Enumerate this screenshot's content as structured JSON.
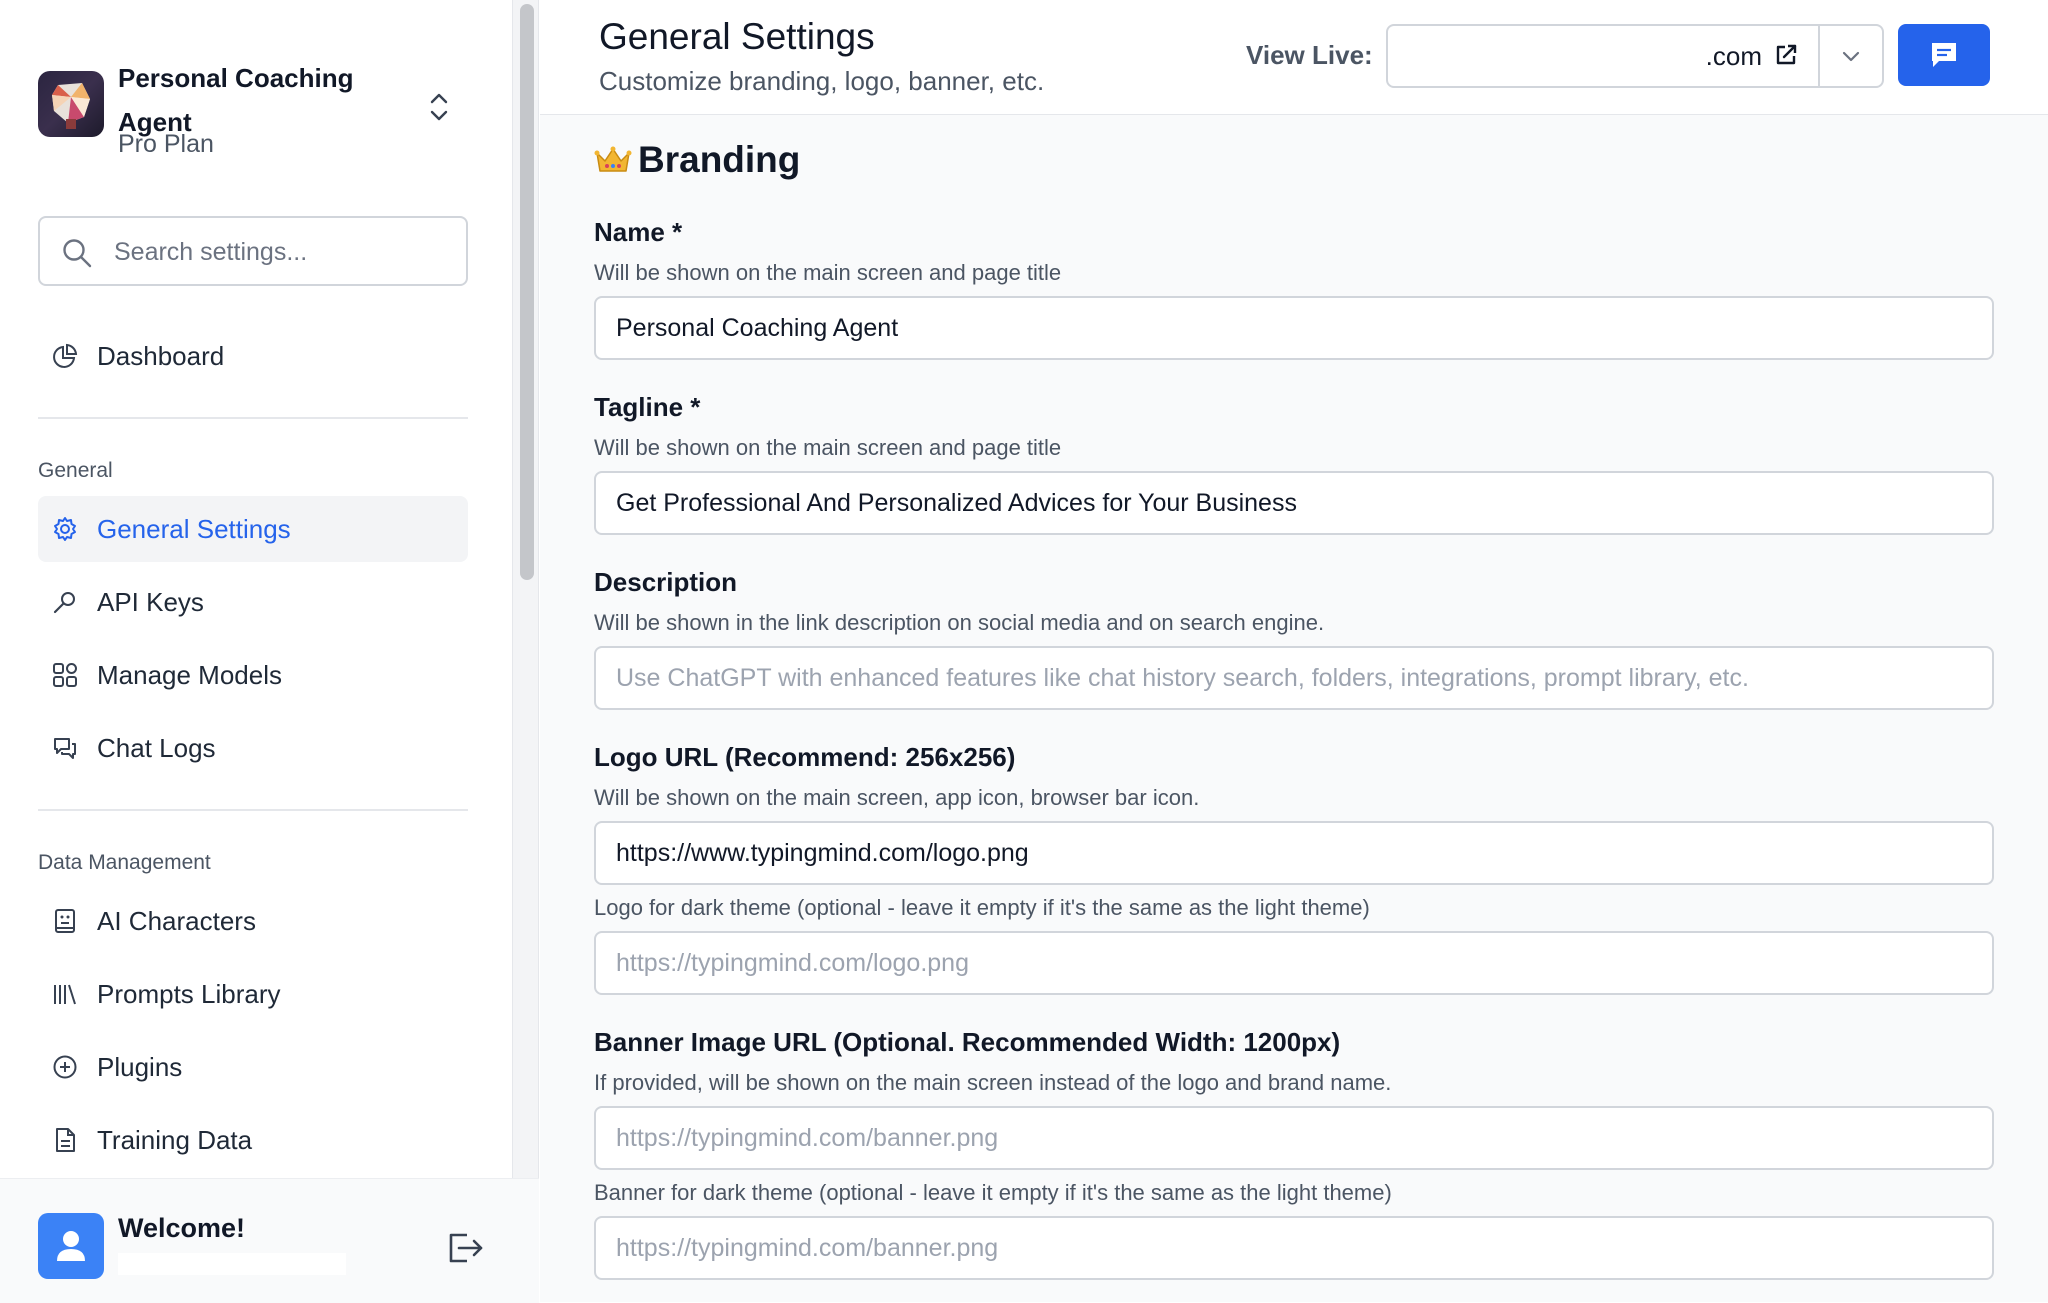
{
  "sidebar": {
    "workspace": {
      "name": "Personal Coaching Agent",
      "plan": "Pro Plan"
    },
    "search_placeholder": "Search settings...",
    "dashboard_label": "Dashboard",
    "general_section": "General",
    "general_items": [
      {
        "label": "General Settings",
        "icon": "gear-icon",
        "active": true
      },
      {
        "label": "API Keys",
        "icon": "key-icon"
      },
      {
        "label": "Manage Models",
        "icon": "grid-icon"
      },
      {
        "label": "Chat Logs",
        "icon": "chat-bubbles-icon"
      }
    ],
    "data_section": "Data Management",
    "data_items": [
      {
        "label": "AI Characters",
        "icon": "character-icon"
      },
      {
        "label": "Prompts Library",
        "icon": "library-icon"
      },
      {
        "label": "Plugins",
        "icon": "plus-circle-icon"
      },
      {
        "label": "Training Data",
        "icon": "document-icon"
      }
    ],
    "footer": {
      "welcome": "Welcome!"
    }
  },
  "header": {
    "title": "General Settings",
    "subtitle": "Customize branding, logo, banner, etc.",
    "view_live_label": "View Live:",
    "view_live_value": ".com"
  },
  "branding": {
    "title": "Branding",
    "name": {
      "label": "Name *",
      "help": "Will be shown on the main screen and page title",
      "value": "Personal Coaching Agent"
    },
    "tagline": {
      "label": "Tagline *",
      "help": "Will be shown on the main screen and page title",
      "value": "Get Professional And Personalized Advices for Your Business"
    },
    "description": {
      "label": "Description",
      "help": "Will be shown in the link description on social media and on search engine.",
      "placeholder": "Use ChatGPT with enhanced features like chat history search, folders, integrations, prompt library, etc."
    },
    "logo": {
      "label": "Logo URL (Recommend: 256x256)",
      "help": "Will be shown on the main screen, app icon, browser bar icon.",
      "value": "https://www.typingmind.com/logo.png",
      "dark_help": "Logo for dark theme (optional - leave it empty if it's the same as the light theme)",
      "dark_placeholder": "https://typingmind.com/logo.png"
    },
    "banner": {
      "label": "Banner Image URL (Optional. Recommended Width: 1200px)",
      "help": "If provided, will be shown on the main screen instead of the logo and brand name.",
      "placeholder": "https://typingmind.com/banner.png",
      "dark_help": "Banner for dark theme (optional - leave it empty if it's the same as the light theme)",
      "dark_placeholder": "https://typingmind.com/banner.png"
    }
  },
  "colors": {
    "accent": "#2563eb",
    "active_bg": "#f3f4f6",
    "border": "#d1d5db"
  }
}
